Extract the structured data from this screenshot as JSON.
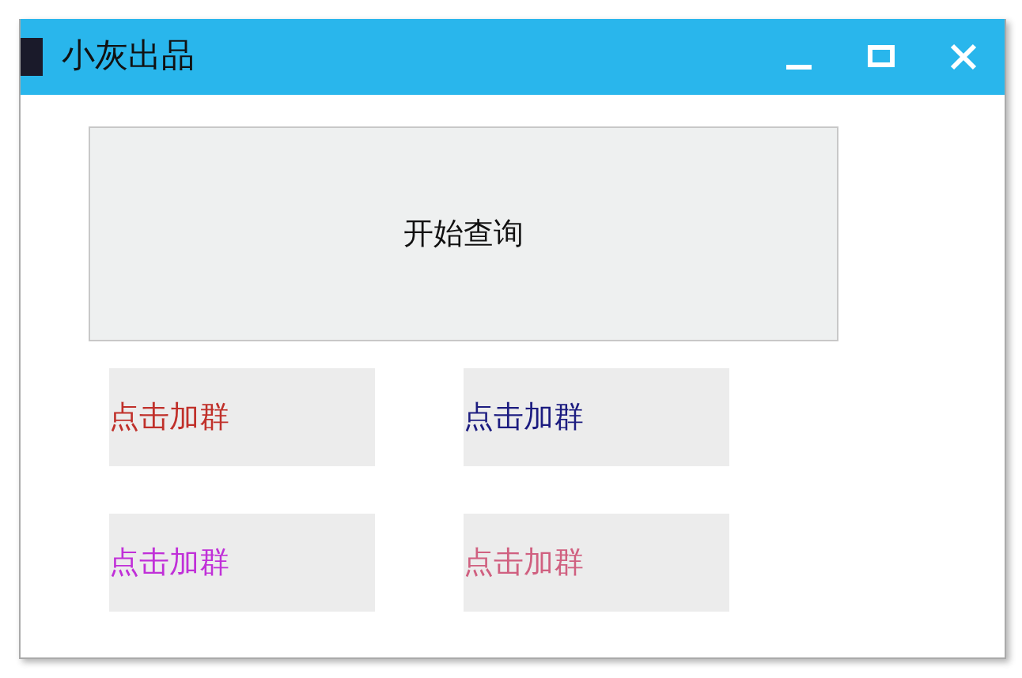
{
  "window": {
    "title": "小灰出品"
  },
  "main_button": {
    "label": "开始查询"
  },
  "links": [
    {
      "label": "点击加群",
      "color": "#c0302a"
    },
    {
      "label": "点击加群",
      "color": "#1c1c80"
    },
    {
      "label": "点击加群",
      "color": "#c030d8"
    },
    {
      "label": "点击加群",
      "color": "#d06080"
    }
  ]
}
